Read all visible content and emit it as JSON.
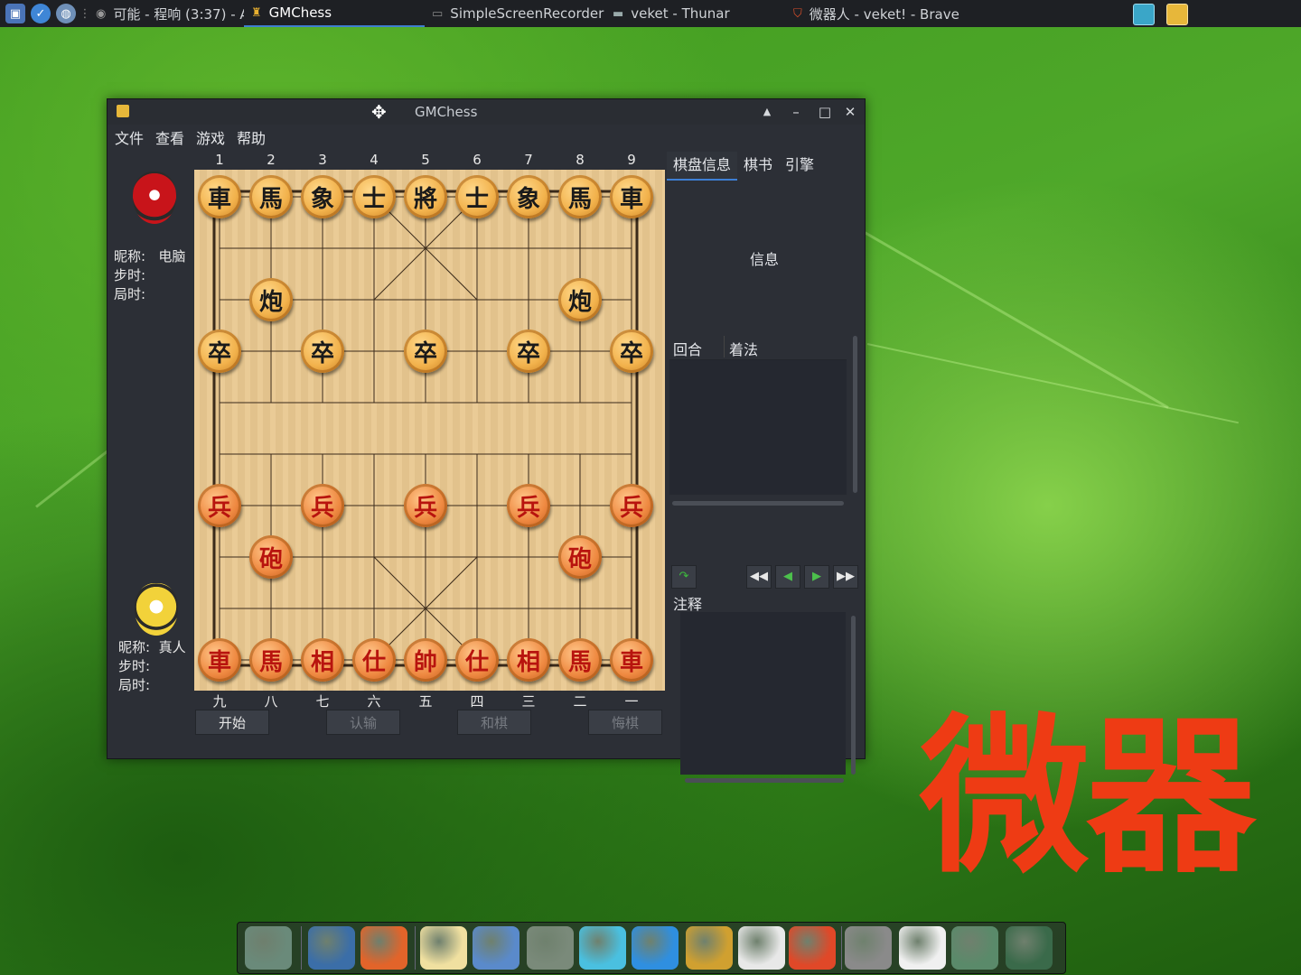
{
  "taskbar": {
    "tasks": [
      {
        "label": "可能 - 程响 (3:37) - A···",
        "icon": "music-player-icon"
      },
      {
        "label": "GMChess",
        "icon": "chess-icon",
        "active": true
      },
      {
        "label": "SimpleScreenRecorder",
        "icon": "window-icon"
      },
      {
        "label": "veket - Thunar",
        "icon": "folder-icon"
      },
      {
        "label": "微器人 - veket! - Brave",
        "icon": "brave-icon"
      }
    ]
  },
  "window": {
    "title": "GMChess",
    "menu": [
      "文件",
      "查看",
      "游戏",
      "帮助"
    ]
  },
  "players": {
    "top": {
      "nick_label": "昵称:",
      "nick_value": "电脑",
      "step_label": "步时:",
      "game_label": "局时:"
    },
    "bottom": {
      "nick_label": "昵称:",
      "nick_value": "真人",
      "step_label": "步时:",
      "game_label": "局时:"
    }
  },
  "board": {
    "top_files": [
      "1",
      "2",
      "3",
      "4",
      "5",
      "6",
      "7",
      "8",
      "9"
    ],
    "bottom_files": [
      "九",
      "八",
      "七",
      "六",
      "五",
      "四",
      "三",
      "二",
      "一"
    ],
    "pieces": [
      {
        "c": 0,
        "r": 0,
        "t": "車",
        "side": "black"
      },
      {
        "c": 1,
        "r": 0,
        "t": "馬",
        "side": "black"
      },
      {
        "c": 2,
        "r": 0,
        "t": "象",
        "side": "black"
      },
      {
        "c": 3,
        "r": 0,
        "t": "士",
        "side": "black"
      },
      {
        "c": 4,
        "r": 0,
        "t": "將",
        "side": "black"
      },
      {
        "c": 5,
        "r": 0,
        "t": "士",
        "side": "black"
      },
      {
        "c": 6,
        "r": 0,
        "t": "象",
        "side": "black"
      },
      {
        "c": 7,
        "r": 0,
        "t": "馬",
        "side": "black"
      },
      {
        "c": 8,
        "r": 0,
        "t": "車",
        "side": "black"
      },
      {
        "c": 1,
        "r": 2,
        "t": "炮",
        "side": "black"
      },
      {
        "c": 7,
        "r": 2,
        "t": "炮",
        "side": "black"
      },
      {
        "c": 0,
        "r": 3,
        "t": "卒",
        "side": "black"
      },
      {
        "c": 2,
        "r": 3,
        "t": "卒",
        "side": "black"
      },
      {
        "c": 4,
        "r": 3,
        "t": "卒",
        "side": "black"
      },
      {
        "c": 6,
        "r": 3,
        "t": "卒",
        "side": "black"
      },
      {
        "c": 8,
        "r": 3,
        "t": "卒",
        "side": "black"
      },
      {
        "c": 0,
        "r": 6,
        "t": "兵",
        "side": "red"
      },
      {
        "c": 2,
        "r": 6,
        "t": "兵",
        "side": "red"
      },
      {
        "c": 4,
        "r": 6,
        "t": "兵",
        "side": "red"
      },
      {
        "c": 6,
        "r": 6,
        "t": "兵",
        "side": "red"
      },
      {
        "c": 8,
        "r": 6,
        "t": "兵",
        "side": "red"
      },
      {
        "c": 1,
        "r": 7,
        "t": "砲",
        "side": "red"
      },
      {
        "c": 7,
        "r": 7,
        "t": "砲",
        "side": "red"
      },
      {
        "c": 0,
        "r": 9,
        "t": "車",
        "side": "red"
      },
      {
        "c": 1,
        "r": 9,
        "t": "馬",
        "side": "red"
      },
      {
        "c": 2,
        "r": 9,
        "t": "相",
        "side": "red"
      },
      {
        "c": 3,
        "r": 9,
        "t": "仕",
        "side": "red"
      },
      {
        "c": 4,
        "r": 9,
        "t": "帥",
        "side": "red"
      },
      {
        "c": 5,
        "r": 9,
        "t": "仕",
        "side": "red"
      },
      {
        "c": 6,
        "r": 9,
        "t": "相",
        "side": "red"
      },
      {
        "c": 7,
        "r": 9,
        "t": "馬",
        "side": "red"
      },
      {
        "c": 8,
        "r": 9,
        "t": "車",
        "side": "red"
      }
    ]
  },
  "buttons": {
    "start": "开始",
    "resign": "认输",
    "draw": "和棋",
    "undo": "悔棋"
  },
  "side": {
    "tabs": [
      "棋盘信息",
      "棋书",
      "引擎"
    ],
    "info_label": "信息",
    "moves_headers": [
      "回合",
      "着法"
    ],
    "notes_label": "注释"
  },
  "watermark": "微器",
  "dock": {
    "icons": [
      "desktop-icon",
      "computer-icon",
      "firefox-icon",
      "text-editor-icon",
      "image-viewer-icon",
      "music-icon",
      "atom-icon",
      "media-player-icon",
      "file-manager-icon",
      "presentation-icon",
      "rocket-icon",
      "drive-icon",
      "settings-icon",
      "network-icon",
      "camera-icon"
    ]
  }
}
